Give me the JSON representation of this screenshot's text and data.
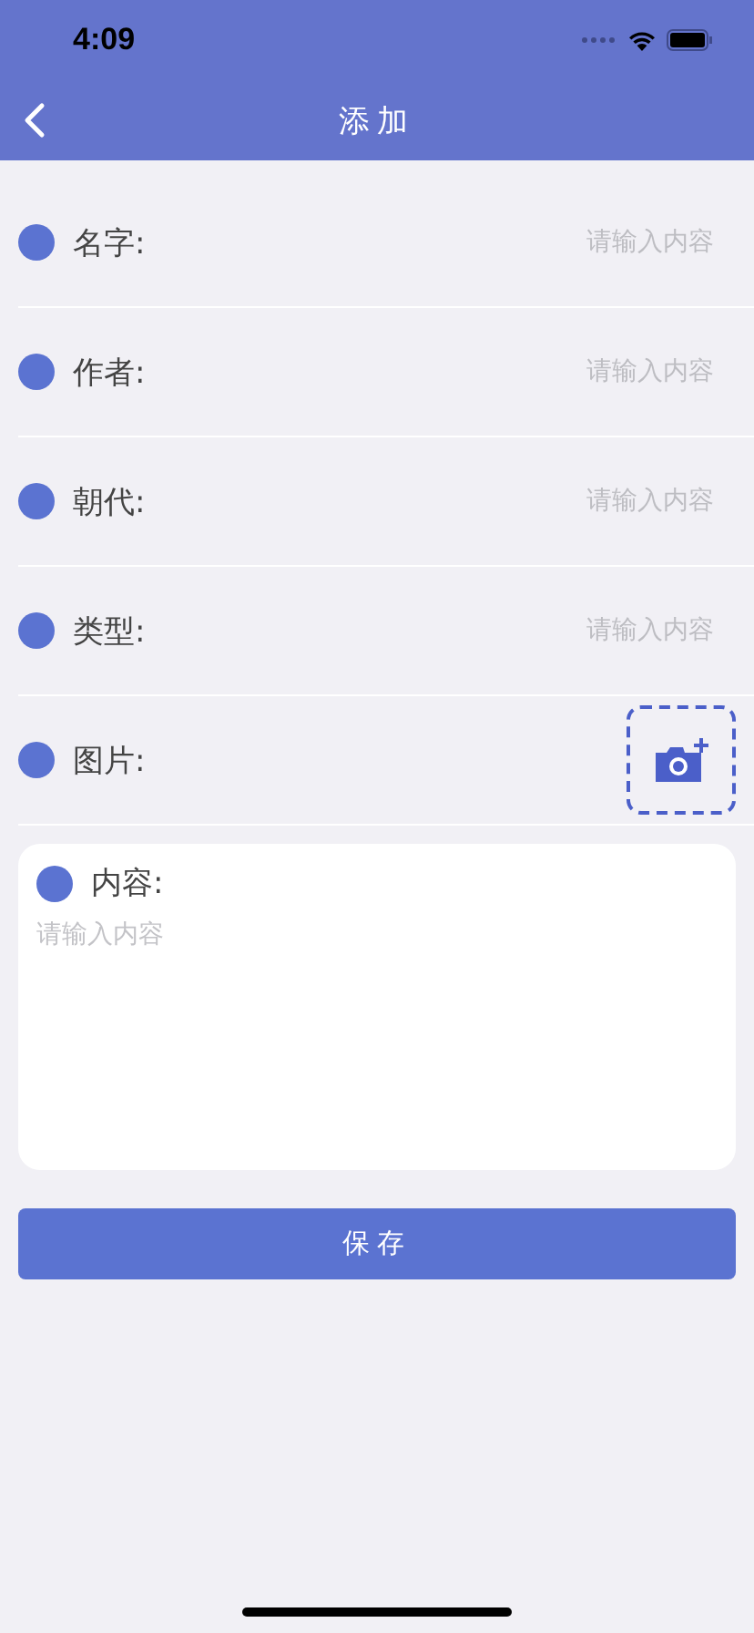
{
  "status_bar": {
    "time": "4:09"
  },
  "nav": {
    "title": "添加"
  },
  "fields": [
    {
      "kind": "text",
      "label": "名字:",
      "placeholder": "请输入内容"
    },
    {
      "kind": "text",
      "label": "作者:",
      "placeholder": "请输入内容"
    },
    {
      "kind": "text",
      "label": "朝代:",
      "placeholder": "请输入内容"
    },
    {
      "kind": "text",
      "label": "类型:",
      "placeholder": "请输入内容"
    },
    {
      "kind": "image",
      "label": "图片:"
    }
  ],
  "content": {
    "label": "内容:",
    "placeholder": "请输入内容"
  },
  "save_button": "保存"
}
